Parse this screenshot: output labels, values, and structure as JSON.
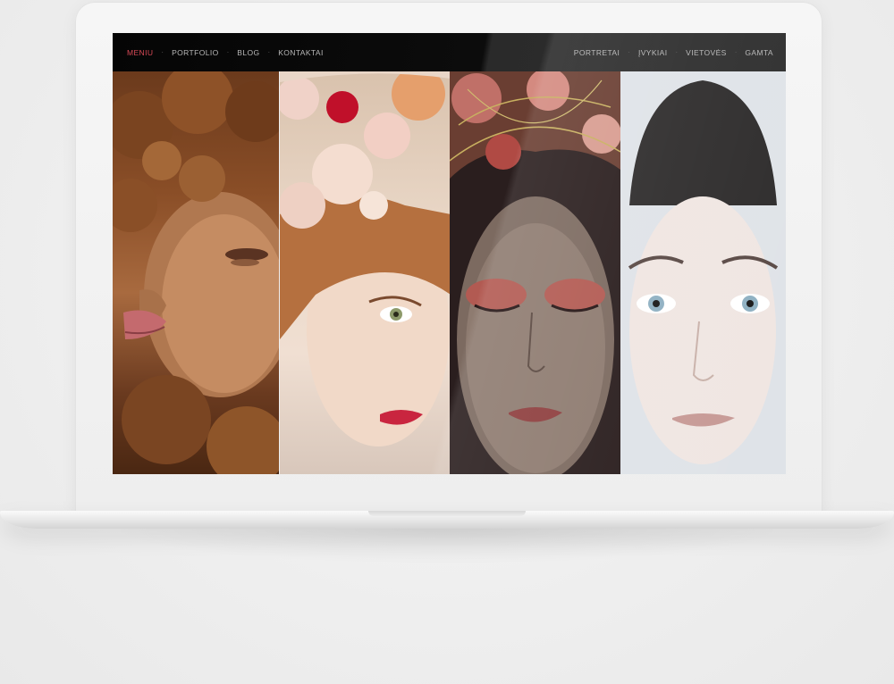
{
  "nav": {
    "left": [
      {
        "label": "MENIU",
        "active": true
      },
      {
        "label": "PORTFOLIO",
        "active": false
      },
      {
        "label": "BLOG",
        "active": false
      },
      {
        "label": "KONTAKTAI",
        "active": false
      }
    ],
    "right": [
      {
        "label": "PORTRETAI"
      },
      {
        "label": "ĮVYKIAI"
      },
      {
        "label": "VIETOVĖS"
      },
      {
        "label": "GAMTA"
      }
    ],
    "separator": "·"
  },
  "gallery": [
    {
      "name": "curly-hair-portrait"
    },
    {
      "name": "flower-crown-portrait"
    },
    {
      "name": "dark-makeup-portrait"
    },
    {
      "name": "clean-face-portrait"
    }
  ],
  "colors": {
    "accent": "#d94a57",
    "nav_text": "#b8b8b8",
    "nav_bg": "#0a0a0a"
  }
}
